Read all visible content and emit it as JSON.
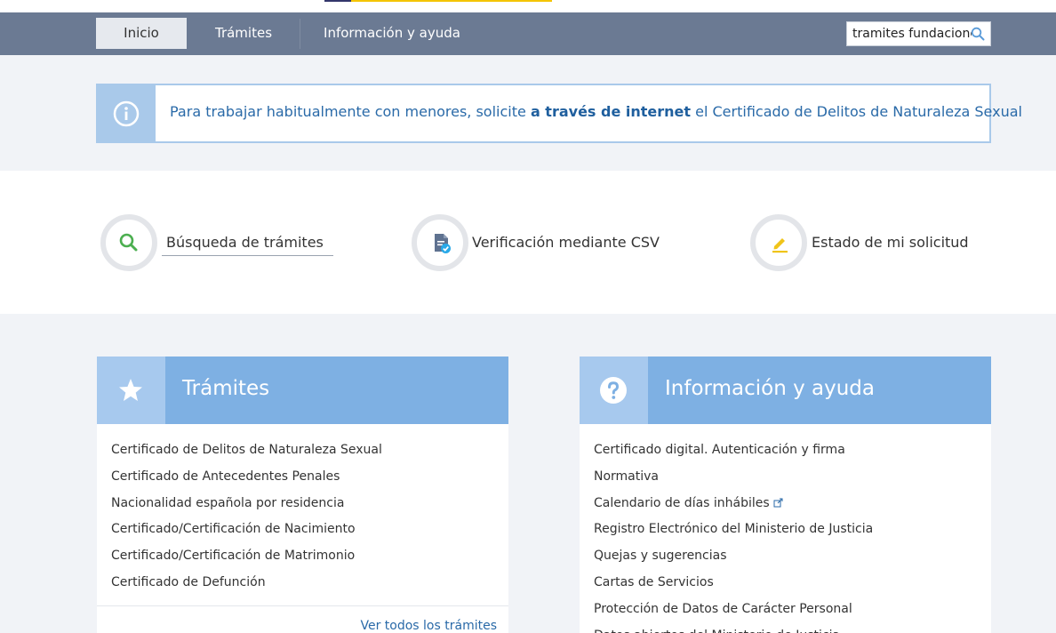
{
  "nav": {
    "items": [
      {
        "label": "Inicio",
        "active": true
      },
      {
        "label": "Trámites",
        "active": false
      },
      {
        "label": "Información y ayuda",
        "active": false
      }
    ],
    "search_value": "tramites fundacione"
  },
  "alert": {
    "text_before": "Para trabajar habitualmente con menores, solicite ",
    "link_text": "a través de internet",
    "text_after": " el Certificado de Delitos de Naturaleza Sexual"
  },
  "quick": {
    "search_label": "Búsqueda de trámites",
    "csv_label": "Verificación mediante CSV",
    "status_label": "Estado de mi solicitud"
  },
  "tramites_panel": {
    "title": "Trámites",
    "items": [
      "Certificado de Delitos de Naturaleza Sexual",
      "Certificado de Antecedentes Penales",
      "Nacionalidad española por residencia",
      "Certificado/Certificación de Nacimiento",
      "Certificado/Certificación de Matrimonio",
      "Certificado de Defunción"
    ],
    "more_link": "Ver todos los trámites"
  },
  "info_panel": {
    "title": "Información y ayuda",
    "items": [
      "Certificado digital. Autenticación y firma",
      "Normativa",
      "Calendario de días inhábiles",
      "Registro Electrónico del Ministerio de Justicia",
      "Quejas y sugerencias",
      "Cartas de Servicios",
      "Protección de Datos de Carácter Personal",
      "Datos abiertos del Ministerio de Justicia"
    ]
  },
  "colors": {
    "nav_bg": "#6b7a93",
    "accent_blue": "#7eb0e3",
    "link_blue": "#2a6aa8",
    "search_green": "#4caf50",
    "pencil_yellow": "#f0c419"
  }
}
